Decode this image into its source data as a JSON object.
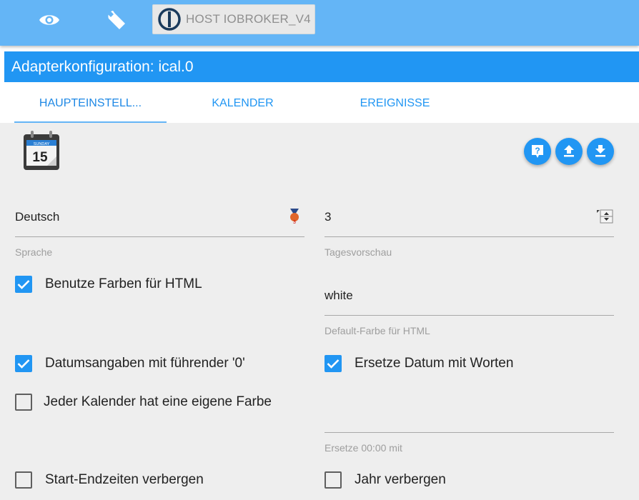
{
  "topbar": {
    "icons": [
      "eye-icon",
      "wrench-icon"
    ],
    "host_label": "HOST IOBROKER_V4"
  },
  "title": "Adapterkonfiguration: ical.0",
  "tabs": [
    {
      "label": "HAUPTEINSTELL...",
      "active": true
    },
    {
      "label": "KALENDER",
      "active": false
    },
    {
      "label": "EREIGNISSE",
      "active": false
    }
  ],
  "calendar_icon": {
    "day_name": "SUNDAY",
    "day_number": "15"
  },
  "actions": [
    "help-icon",
    "upload-icon",
    "download-icon"
  ],
  "fields": {
    "language": {
      "value": "Deutsch",
      "label": "Sprache"
    },
    "days_preview": {
      "value": "3",
      "label": "Tagesvorschau"
    },
    "default_color": {
      "value": "white",
      "label": "Default-Farbe für HTML"
    },
    "replace_midnight": {
      "value": "",
      "label": "Ersetze 00:00 mit"
    }
  },
  "checkboxes": {
    "use_colors": {
      "label": "Benutze Farben für HTML",
      "checked": true
    },
    "leading_zero": {
      "label": "Datumsangaben mit führender '0'",
      "checked": true
    },
    "replace_date": {
      "label": "Ersetze Datum mit Worten",
      "checked": true
    },
    "own_color": {
      "label": "Jeder Kalender hat eine eigene Farbe",
      "checked": false
    },
    "hide_times": {
      "label": "Start-Endzeiten verbergen",
      "checked": false
    },
    "hide_year": {
      "label": "Jahr verbergen",
      "checked": false
    }
  },
  "colors": {
    "accent": "#2196f3",
    "topbar": "#64b5f6",
    "content_bg": "#eeeeee"
  }
}
